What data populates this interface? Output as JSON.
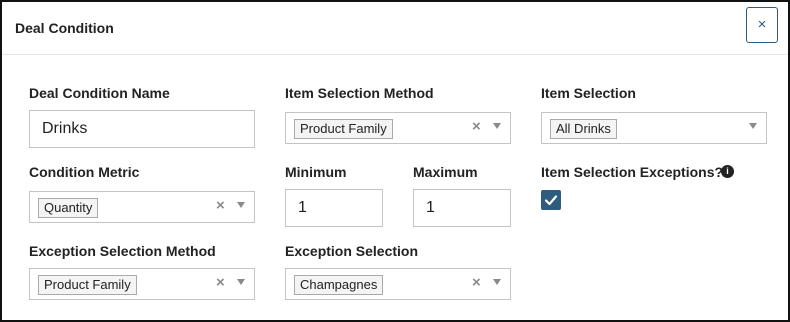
{
  "dialog": {
    "title": "Deal Condition",
    "close_label": "×"
  },
  "fields": {
    "deal_condition_name": {
      "label": "Deal Condition Name",
      "value": "Drinks"
    },
    "item_selection_method": {
      "label": "Item Selection Method",
      "value": "Product Family"
    },
    "item_selection": {
      "label": "Item Selection",
      "value": "All Drinks"
    },
    "condition_metric": {
      "label": "Condition Metric",
      "value": "Quantity"
    },
    "minimum": {
      "label": "Minimum",
      "value": "1"
    },
    "maximum": {
      "label": "Maximum",
      "value": "1"
    },
    "item_selection_exceptions": {
      "label": "Item Selection Exceptions?",
      "info_glyph": "i",
      "checked": true
    },
    "exception_selection_method": {
      "label": "Exception Selection Method",
      "value": "Product Family"
    },
    "exception_selection": {
      "label": "Exception Selection",
      "value": "Champagnes"
    }
  },
  "icons": {
    "clear": "×",
    "checkmark": "check-icon"
  },
  "colors": {
    "accent": "#2e5c7f",
    "border": "#c4c4c4",
    "tag_bg": "#f4f4f4"
  }
}
